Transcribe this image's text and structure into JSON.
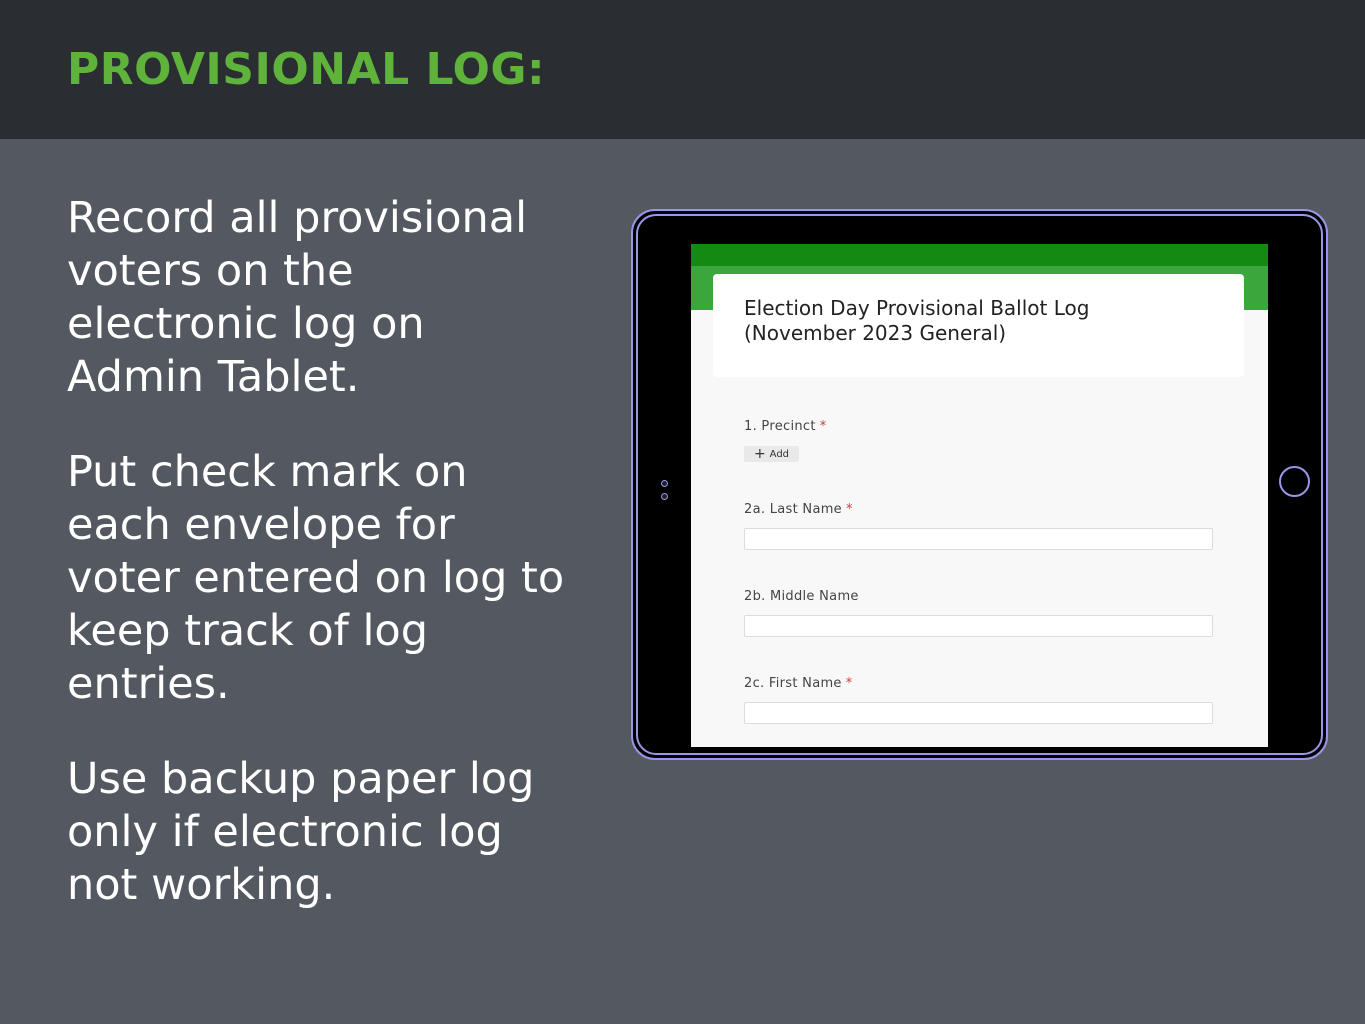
{
  "slide": {
    "title": "PROVISIONAL LOG:",
    "paragraphs": [
      "Record all provisional voters on the electronic log on Admin Tablet.",
      "Put check mark on each envelope for voter entered on log to keep track of log entries.",
      "Use backup paper log only if electronic log not working."
    ]
  },
  "form": {
    "title_line1": "Election Day Provisional Ballot Log",
    "title_line2": "(November 2023 General)",
    "questions": [
      {
        "label": "1. Precinct",
        "required": "*",
        "action_label": "Add",
        "action_icon": "plus-icon"
      },
      {
        "label": "2a. Last Name",
        "required": "*",
        "value": ""
      },
      {
        "label": "2b. Middle Name",
        "value": ""
      },
      {
        "label": "2c. First Name",
        "required": "*",
        "value": ""
      }
    ]
  },
  "colors": {
    "title": "#5fb33b",
    "header_bg": "#2a2d31",
    "slide_bg": "#545860",
    "form_green_dark": "#138a10",
    "form_green": "#3aa63b",
    "tablet_outline": "#9a96e6"
  }
}
